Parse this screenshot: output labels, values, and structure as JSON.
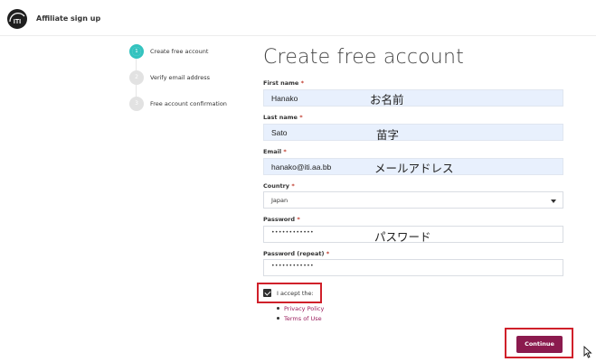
{
  "header": {
    "title": "Affiliate sign up",
    "logo_text": "ITI"
  },
  "steps": [
    {
      "number": "1",
      "label": "Create free account",
      "active": true
    },
    {
      "number": "2",
      "label": "Verify email address",
      "active": false
    },
    {
      "number": "3",
      "label": "Free account confirmation",
      "active": false
    }
  ],
  "form": {
    "title": "Create free account",
    "required_mark": "*",
    "first_name": {
      "label": "First name",
      "value": "Hanako",
      "annotation": "お名前"
    },
    "last_name": {
      "label": "Last name",
      "value": "Sato",
      "annotation": "苗字"
    },
    "email": {
      "label": "Email",
      "value": "hanako@iti.aa.bb",
      "annotation": "メールアドレス"
    },
    "country": {
      "label": "Country",
      "value": "Japan"
    },
    "password": {
      "label": "Password",
      "value": "••••••••••••",
      "annotation": "パスワード"
    },
    "password_repeat": {
      "label": "Password (repeat)",
      "value": "••••••••••••"
    },
    "accept": {
      "label": "I accept the:",
      "checked": true
    },
    "links": [
      "Privacy Policy",
      "Terms of Use"
    ],
    "continue_label": "Continue"
  },
  "colors": {
    "accent": "#34c3bf",
    "brand": "#8b1a4e",
    "highlight": "#d0202a",
    "autofill": "#e8f0fd"
  }
}
